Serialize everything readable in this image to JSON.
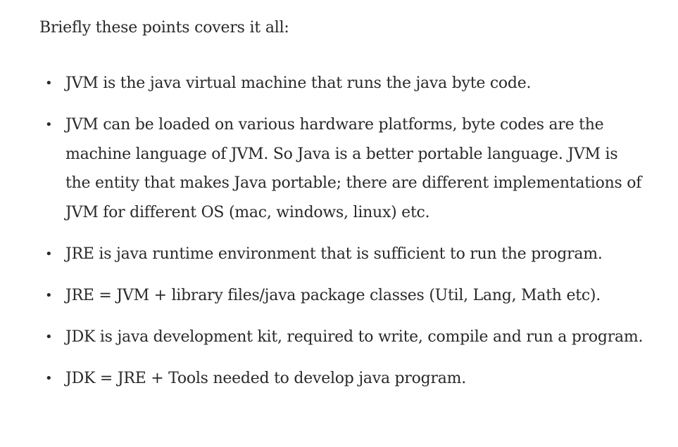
{
  "article": {
    "intro": "Briefly these points covers it all:",
    "bullet_glyph": "•",
    "points": [
      "JVM is the java virtual machine that runs the java byte code.",
      "JVM can be loaded on various hardware platforms, byte codes are the machine language of JVM. So Java is a better portable language. JVM is the entity that makes Java portable; there are different implementations of JVM for different OS (mac, windows, linux) etc.",
      "JRE is java runtime environment that is sufficient to run the program.",
      "JRE = JVM + library files/java package classes (Util, Lang, Math etc).",
      "JDK is java development kit, required to write, compile and run a program.",
      "JDK = JRE + Tools needed to develop java program."
    ]
  }
}
